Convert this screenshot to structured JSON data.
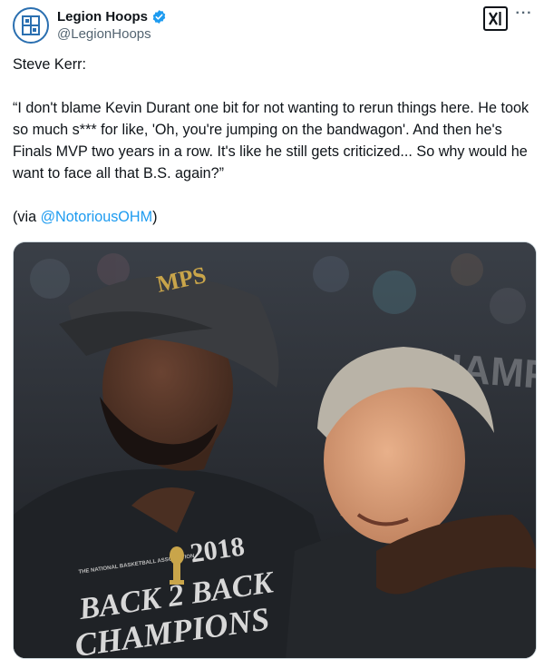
{
  "author": {
    "display_name": "Legion Hoops",
    "handle": "@LegionHoops",
    "verified_icon": "verified-badge-icon",
    "avatar_icon": "legion-hoops-logo"
  },
  "actions": {
    "grok_icon": "grok-icon",
    "more_label": "···"
  },
  "tweet": {
    "line1": "Steve Kerr:",
    "quote": "“I don't blame Kevin Durant one bit for not wanting to rerun things here. He took so much s*** for like, 'Oh, you're jumping on the bandwagon'. And then he's Finals MVP two years in a row. It's like he still gets criticized... So why would he want to face all that B.S. again?”",
    "via_prefix": "(via ",
    "via_mention": "@NotoriousOHM",
    "via_suffix": ")"
  },
  "media": {
    "shirt_year": "2018",
    "shirt_line1": "BACK 2 BACK",
    "shirt_line2": "CHAMPIONS",
    "shirt_small": "THE NATIONAL BASKETBALL ASSOCIATION",
    "banner_text": "CHAMPIO",
    "colors": {
      "background": "#2b2f36",
      "skin_dark": "#4a2f22",
      "skin_light": "#d9a07c",
      "hair_light": "#b9b3a7",
      "shirt": "#1f2226",
      "cap": "#3a3c40"
    }
  },
  "colors": {
    "link": "#1d9bf0",
    "verified": "#1d9bf0",
    "secondary_text": "#536471"
  }
}
